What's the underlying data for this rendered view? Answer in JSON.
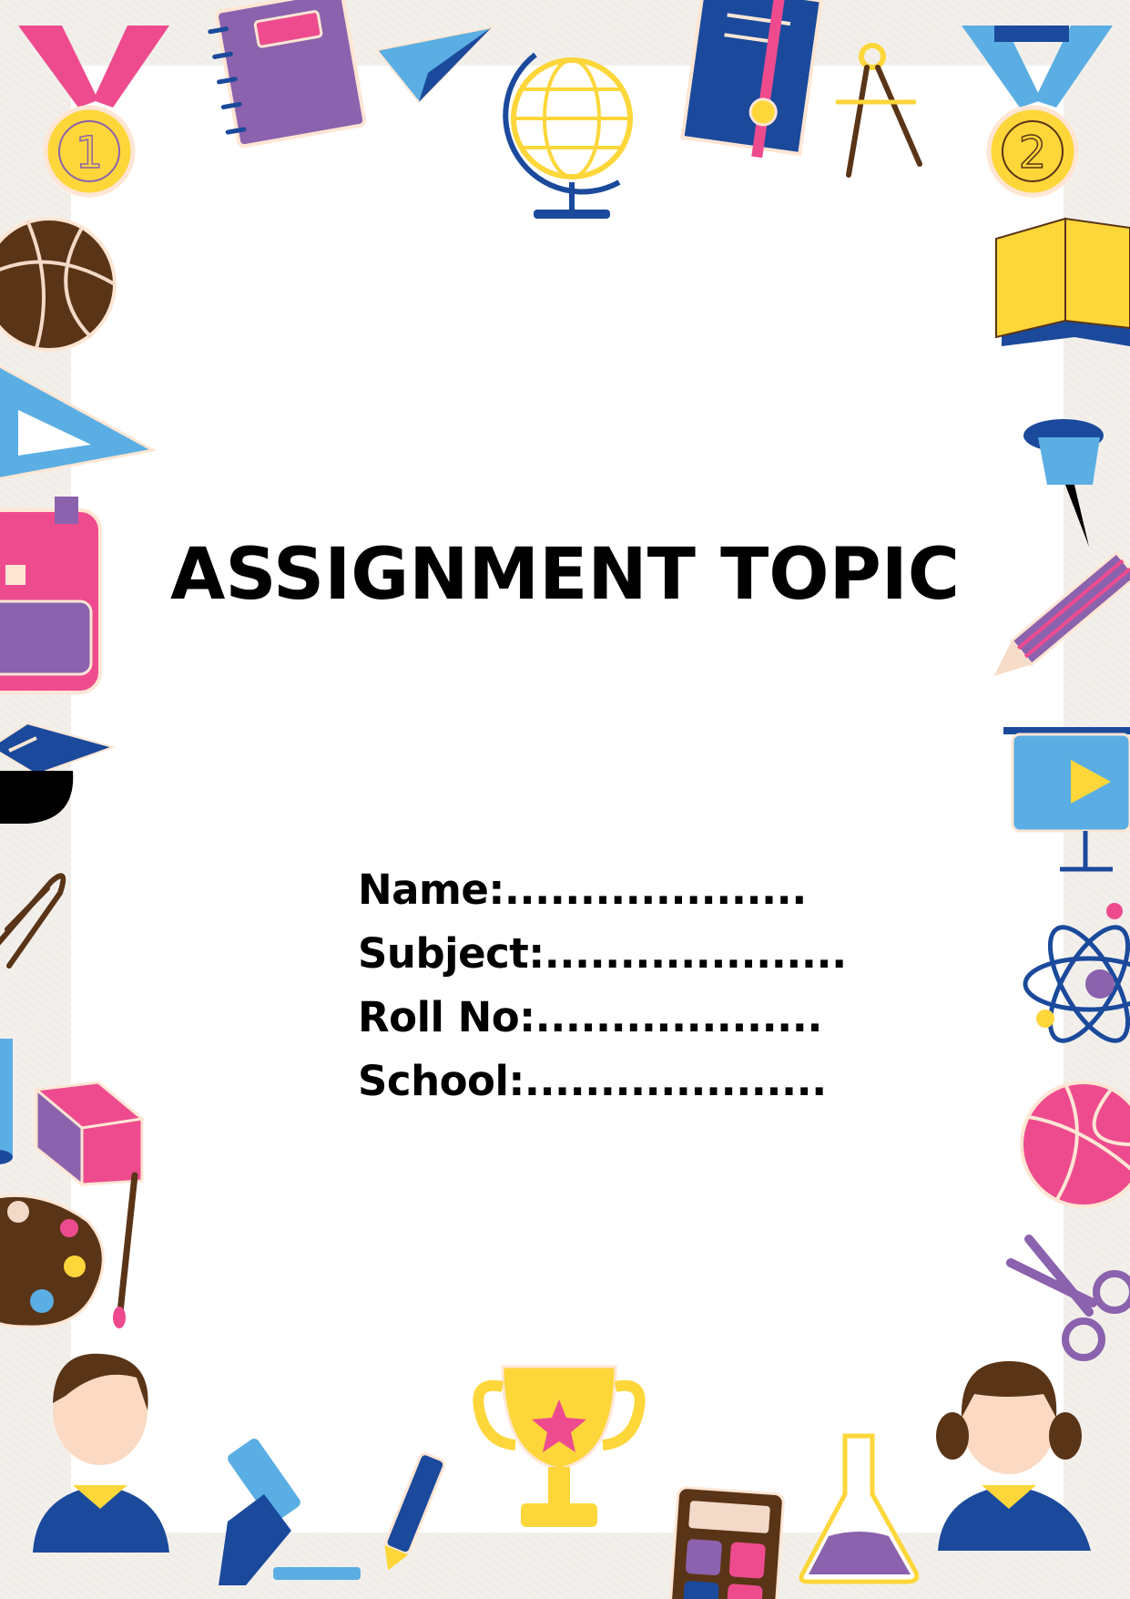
{
  "document": {
    "title": "ASSIGNMENT TOPIC",
    "fields": [
      "Name:....................",
      "Subject:....................",
      "Roll No:...................",
      "School:...................."
    ]
  },
  "decorations": {
    "medal_left_number": "1",
    "medal_right_number": "2"
  },
  "colors": {
    "pink": "#ee4b8f",
    "purple": "#8b62ad",
    "navy": "#1b4a9c",
    "sky": "#5aaee3",
    "yellow": "#fdd63a",
    "brown": "#5a3416",
    "cream": "#ffe6d4"
  }
}
